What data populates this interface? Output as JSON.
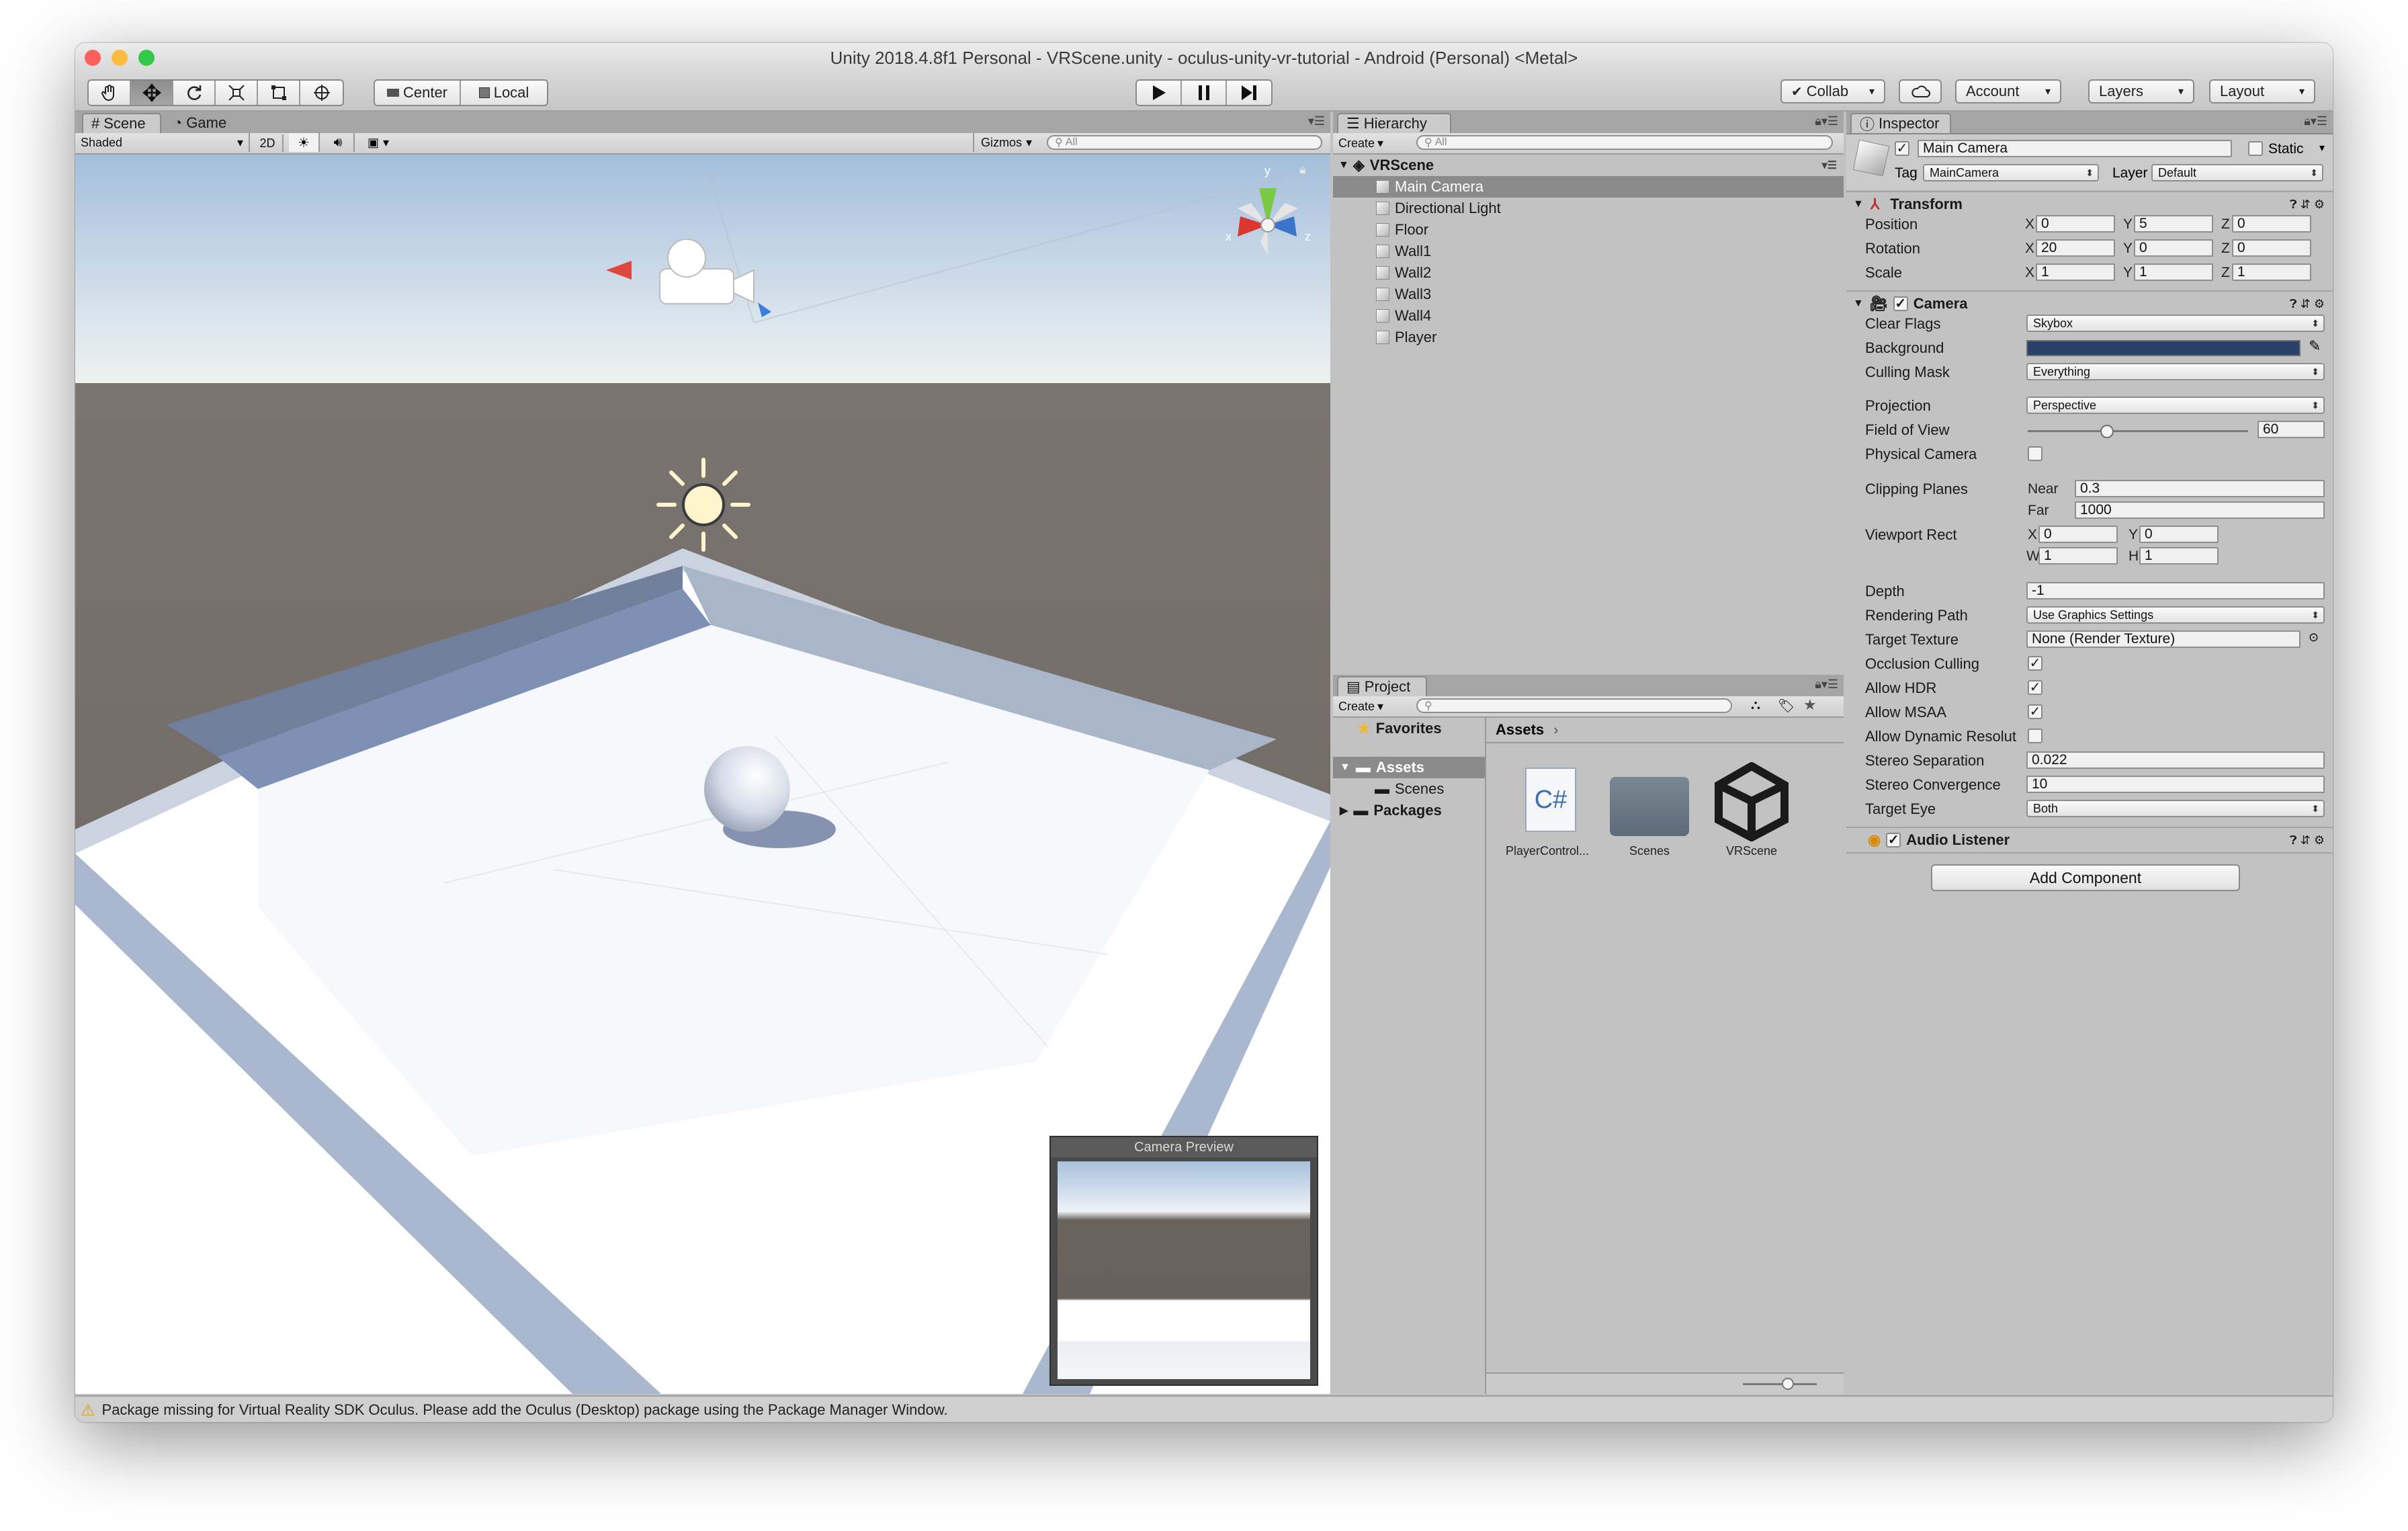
{
  "window": {
    "title": "Unity 2018.4.8f1 Personal - VRScene.unity - oculus-unity-vr-tutorial - Android (Personal) <Metal>"
  },
  "toolbar": {
    "pivot_center": "Center",
    "pivot_local": "Local",
    "collab": "Collab",
    "account": "Account",
    "layers": "Layers",
    "layout": "Layout",
    "dropdown_arrow": "▾"
  },
  "scene": {
    "tab_scene": "Scene",
    "tab_game": "Game",
    "shading": "Shaded",
    "mode_2d": "2D",
    "gizmos": "Gizmos",
    "search_placeholder": "All",
    "gizmo_axes": {
      "x": "x",
      "y": "y",
      "z": "z"
    },
    "camera_preview_title": "Camera Preview"
  },
  "hierarchy": {
    "tab": "Hierarchy",
    "create": "Create",
    "search_placeholder": "All",
    "scene_name": "VRScene",
    "items": [
      "Main Camera",
      "Directional Light",
      "Floor",
      "Wall1",
      "Wall2",
      "Wall3",
      "Wall4",
      "Player"
    ]
  },
  "project": {
    "tab": "Project",
    "create": "Create",
    "favorites": "Favorites",
    "assets_folder": "Assets",
    "scenes_folder": "Scenes",
    "packages_folder": "Packages",
    "breadcrumb": "Assets",
    "assets": [
      {
        "name": "PlayerControl...",
        "icon_text": "C#"
      },
      {
        "name": "Scenes"
      },
      {
        "name": "VRScene"
      }
    ]
  },
  "inspector": {
    "tab": "Inspector",
    "object_name": "Main Camera",
    "static": "Static",
    "tag_label": "Tag",
    "tag_value": "MainCamera",
    "layer_label": "Layer",
    "layer_value": "Default",
    "transform": {
      "title": "Transform",
      "rows": [
        {
          "label": "Position",
          "x": "0",
          "y": "5",
          "z": "0"
        },
        {
          "label": "Rotation",
          "x": "20",
          "y": "0",
          "z": "0"
        },
        {
          "label": "Scale",
          "x": "1",
          "y": "1",
          "z": "1"
        }
      ]
    },
    "axis_labels": {
      "x": "X",
      "y": "Y",
      "z": "Z",
      "w": "W",
      "h": "H"
    },
    "camera": {
      "title": "Camera",
      "clear_flags_label": "Clear Flags",
      "clear_flags": "Skybox",
      "background_label": "Background",
      "background_color": "#2a3f6a",
      "culling_mask_label": "Culling Mask",
      "culling_mask": "Everything",
      "projection_label": "Projection",
      "projection": "Perspective",
      "fov_label": "Field of View",
      "fov": "60",
      "fov_slider_fraction": 0.36,
      "physical_label": "Physical Camera",
      "clipping_label": "Clipping Planes",
      "near_label": "Near",
      "near": "0.3",
      "far_label": "Far",
      "far": "1000",
      "viewport_label": "Viewport Rect",
      "vp_x": "0",
      "vp_y": "0",
      "vp_w": "1",
      "vp_h": "1",
      "depth_label": "Depth",
      "depth": "-1",
      "rendering_path_label": "Rendering Path",
      "rendering_path": "Use Graphics Settings",
      "target_texture_label": "Target Texture",
      "target_texture": "None (Render Texture)",
      "occlusion_label": "Occlusion Culling",
      "hdr_label": "Allow HDR",
      "msaa_label": "Allow MSAA",
      "dyn_res_label": "Allow Dynamic Resolut",
      "stereo_sep_label": "Stereo Separation",
      "stereo_sep": "0.022",
      "stereo_conv_label": "Stereo Convergence",
      "stereo_conv": "10",
      "target_eye_label": "Target Eye",
      "target_eye": "Both"
    },
    "audio_listener": "Audio Listener",
    "add_component": "Add Component"
  },
  "status": {
    "message": "Package missing for Virtual Reality SDK Oculus. Please add the Oculus (Desktop) package using the Package Manager Window."
  }
}
